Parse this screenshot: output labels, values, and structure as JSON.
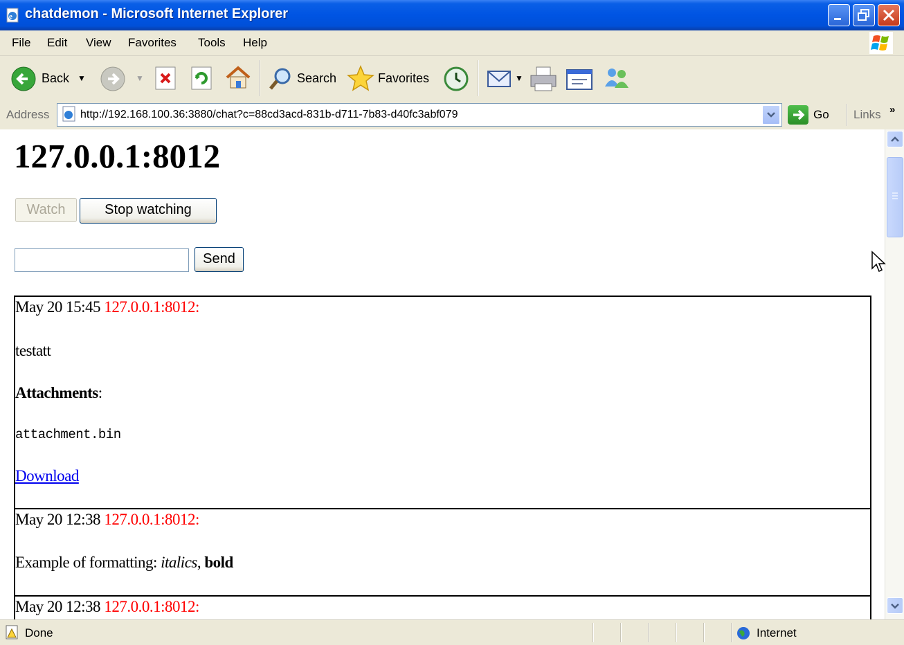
{
  "window": {
    "title": "chatdemon - Microsoft Internet Explorer"
  },
  "menu": {
    "items": [
      "File",
      "Edit",
      "View",
      "Favorites",
      "Tools",
      "Help"
    ]
  },
  "toolbar": {
    "back_label": "Back",
    "search_label": "Search",
    "favorites_label": "Favorites"
  },
  "address": {
    "label": "Address",
    "url": "http://192.168.100.36:3880/chat?c=88cd3acd-831b-d711-7b83-d40fc3abf079",
    "go_label": "Go",
    "links_label": "Links"
  },
  "page": {
    "title": "127.0.0.1:8012",
    "watch_label": "Watch",
    "stop_label": "Stop watching",
    "message_input_value": "",
    "send_label": "Send"
  },
  "messages": [
    {
      "time": "May 20 15:45",
      "sender": "127.0.0.1:8012:",
      "text": "testatt",
      "attachments_label": "Attachments",
      "attachments_colon": ":",
      "filename": "attachment.bin",
      "download_label": "Download"
    },
    {
      "time": "May 20 12:38",
      "sender": "127.0.0.1:8012:",
      "text_prefix": "Example of formatting: ",
      "italic": "italics",
      "separator": ", ",
      "bold": "bold"
    },
    {
      "time": "May 20 12:38",
      "sender": "127.0.0.1:8012:"
    }
  ],
  "status": {
    "text": "Done",
    "zone": "Internet"
  },
  "colors": {
    "titlebar": "#0054e3",
    "sender": "#ff0000",
    "link": "#0000ee",
    "chrome": "#ece9d8"
  }
}
